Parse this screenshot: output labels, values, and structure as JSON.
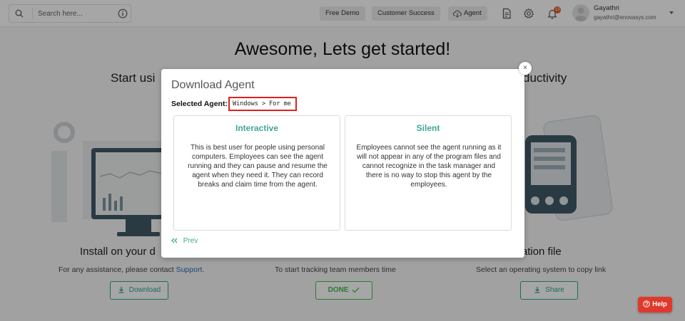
{
  "topbar": {
    "search_placeholder": "Search here...",
    "nav": {
      "free_demo": "Free Demo",
      "customer_success": "Customer Success",
      "agent": "Agent"
    },
    "notification_count": "13",
    "user": {
      "name": "Gayathri",
      "email": "gayathri@enovasys.com"
    }
  },
  "page": {
    "heading": "Awesome, Lets get started!",
    "subheading_left": "Start usi",
    "subheading_right": "ductivity",
    "columns": [
      {
        "title": "Install on your d",
        "text_prefix": "For any assistance, please contact ",
        "text_link": "Support.",
        "button": "Download"
      },
      {
        "title": "",
        "text": "To start tracking team members time",
        "button": "DONE"
      },
      {
        "title": "e installation file",
        "text": "Select an operating system to copy link",
        "button": "Share"
      }
    ]
  },
  "modal": {
    "title": "Download Agent",
    "selected_label": "Selected Agent:",
    "selected_value": "Windows > For me",
    "cards": [
      {
        "title": "Interactive",
        "description": "This is best user for people using personal computers. Employees can see the agent running and they can pause and resume the agent when they need it. They can record breaks and claim time from the agent."
      },
      {
        "title": "Silent",
        "description": "Employees cannot see the agent running as it will not appear in any of the program files and cannot recognize in the task manager and there is no way to stop this agent by the employees."
      }
    ],
    "prev_label": "Prev",
    "close_glyph": "×"
  },
  "help": {
    "label": "Help"
  },
  "colors": {
    "accent": "#3ea897",
    "help": "#e0392b",
    "highlight_border": "#e02020",
    "link": "#2a6fb6"
  }
}
